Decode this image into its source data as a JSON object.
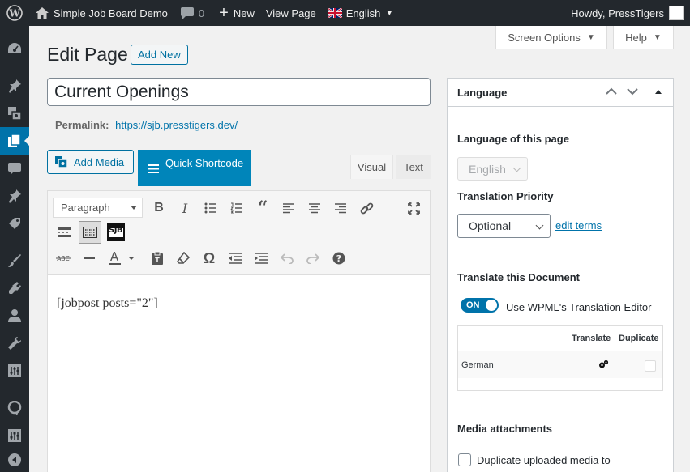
{
  "admin_bar": {
    "site_name": "Simple Job Board Demo",
    "comments_count": "0",
    "new_label": "New",
    "view_page_label": "View Page",
    "language_label": "English",
    "howdy": "Howdy, PressTigers"
  },
  "help_tabs": {
    "screen_options": "Screen Options",
    "help": "Help"
  },
  "page": {
    "title": "Edit Page",
    "add_new": "Add New",
    "post_title": "Current Openings",
    "permalink_label": "Permalink:",
    "permalink_url": "https://sjb.presstigers.dev/"
  },
  "editor": {
    "add_media": "Add Media",
    "quick_shortcode": "Quick Shortcode",
    "tab_visual": "Visual",
    "tab_text": "Text",
    "format_select": "Paragraph",
    "sjb_button": "SJB",
    "content": "[jobpost posts=\"2\"]"
  },
  "language_box": {
    "title": "Language",
    "language_of_page_label": "Language of this page",
    "language_value": "English",
    "translation_priority_label": "Translation Priority",
    "priority_value": "Optional",
    "edit_terms": "edit terms",
    "translate_doc_label": "Translate this Document",
    "toggle_state": "ON",
    "toggle_label": "Use WPML's Translation Editor",
    "table": {
      "col_translate": "Translate",
      "col_duplicate": "Duplicate",
      "rows": [
        {
          "language": "German"
        }
      ]
    },
    "media_attachments_label": "Media attachments",
    "duplicate_media_label": "Duplicate uploaded media to"
  },
  "colors": {
    "admin_bar_bg": "#23282d",
    "accent": "#0073aa",
    "page_bg": "#f1f1f1"
  }
}
